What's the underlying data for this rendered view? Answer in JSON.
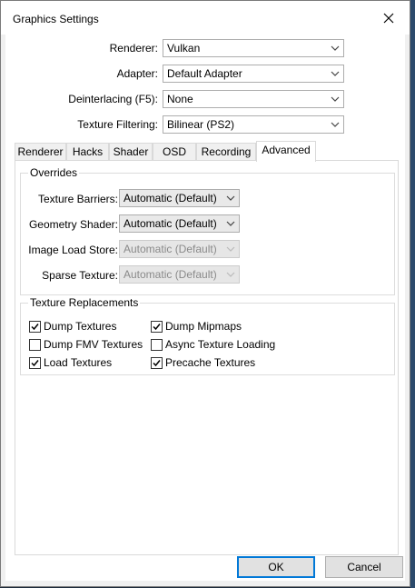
{
  "window": {
    "title": "Graphics Settings"
  },
  "top_settings": [
    {
      "label": "Renderer:",
      "value": "Vulkan"
    },
    {
      "label": "Adapter:",
      "value": "Default Adapter"
    },
    {
      "label": "Deinterlacing (F5):",
      "value": "None"
    },
    {
      "label": "Texture Filtering:",
      "value": "Bilinear (PS2)"
    }
  ],
  "tabs": [
    "Renderer",
    "Hacks",
    "Shader",
    "OSD",
    "Recording",
    "Advanced"
  ],
  "active_tab": "Advanced",
  "overrides": {
    "title": "Overrides",
    "rows": [
      {
        "label": "Texture Barriers:",
        "value": "Automatic (Default)",
        "enabled": true
      },
      {
        "label": "Geometry Shader:",
        "value": "Automatic (Default)",
        "enabled": true
      },
      {
        "label": "Image Load Store:",
        "value": "Automatic (Default)",
        "enabled": false
      },
      {
        "label": "Sparse Texture:",
        "value": "Automatic (Default)",
        "enabled": false
      }
    ]
  },
  "texture_replacements": {
    "title": "Texture Replacements",
    "checkboxes": [
      {
        "label": "Dump Textures",
        "checked": true
      },
      {
        "label": "Dump Mipmaps",
        "checked": true
      },
      {
        "label": "Dump FMV Textures",
        "checked": false
      },
      {
        "label": "Async Texture Loading",
        "checked": false
      },
      {
        "label": "Load Textures",
        "checked": true
      },
      {
        "label": "Precache Textures",
        "checked": true
      }
    ]
  },
  "buttons": {
    "ok": "OK",
    "cancel": "Cancel"
  }
}
